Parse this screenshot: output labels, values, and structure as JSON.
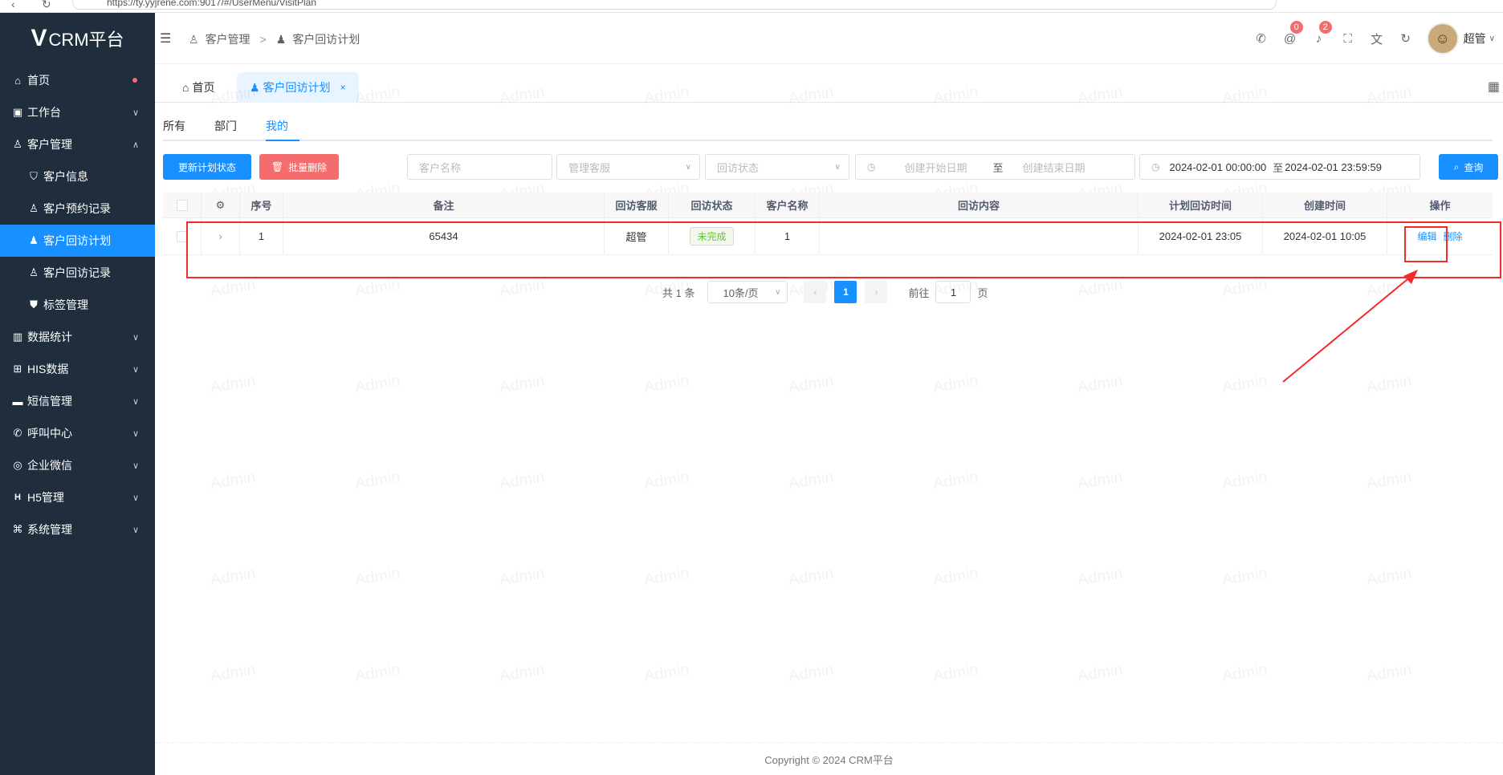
{
  "browser": {
    "url": "https://ty.yyjrene.com:9017/#/UserMenu/VisitPlan"
  },
  "app": {
    "title": "CRM平台",
    "logo_mark": "V"
  },
  "sidebar": {
    "items": [
      {
        "label": "首页",
        "icon": "home-icon"
      },
      {
        "label": "工作台",
        "icon": "briefcase-icon"
      },
      {
        "label": "客户管理",
        "icon": "user-icon"
      },
      {
        "label": "客户信息",
        "icon": "shield-user-icon"
      },
      {
        "label": "客户预约记录",
        "icon": "user-icon"
      },
      {
        "label": "客户回访计划",
        "icon": "user-filled-icon"
      },
      {
        "label": "客户回访记录",
        "icon": "user-icon"
      },
      {
        "label": "标签管理",
        "icon": "shield-check-icon"
      },
      {
        "label": "数据统计",
        "icon": "bar-chart-icon"
      },
      {
        "label": "HIS数据",
        "icon": "medical-box-icon"
      },
      {
        "label": "短信管理",
        "icon": "message-icon"
      },
      {
        "label": "呼叫中心",
        "icon": "phone-icon"
      },
      {
        "label": "企业微信",
        "icon": "wechat-icon"
      },
      {
        "label": "H5管理",
        "icon": "h5-icon"
      },
      {
        "label": "系统管理",
        "icon": "command-icon"
      }
    ]
  },
  "header": {
    "breadcrumb": [
      "客户管理",
      "客户回访计划"
    ],
    "badges": {
      "mentions": "0",
      "notifications": "2"
    },
    "user_name": "超管"
  },
  "tags_view": {
    "home": "首页",
    "current": "客户回访计划"
  },
  "subtabs": [
    "所有",
    "部门",
    "我的"
  ],
  "toolbar": {
    "update_button": "更新计划状态",
    "batch_delete_button": "批量删除",
    "customer_name_placeholder": "客户名称",
    "manager_placeholder": "管理客服",
    "status_placeholder": "回访状态",
    "create_start_placeholder": "创建开始日期",
    "create_end_placeholder": "创建结束日期",
    "range_to": "至",
    "plan_start": "2024-02-01 00:00:00",
    "plan_end": "2024-02-01 23:59:59",
    "query_button": "查询"
  },
  "table": {
    "headers": [
      "序号",
      "备注",
      "回访客服",
      "回访状态",
      "客户名称",
      "回访内容",
      "计划回访时间",
      "创建时间",
      "操作"
    ],
    "rows": [
      {
        "index": "1",
        "remark": "65434",
        "agent": "超管",
        "status": "未完成",
        "customer": "1",
        "content": "",
        "plan_time": "2024-02-01 23:05",
        "create_time": "2024-02-01 10:05",
        "edit": "编辑",
        "delete": "删除"
      }
    ]
  },
  "pagination": {
    "total": "共 1 条",
    "page_size": "10条/页",
    "current_page": "1",
    "goto_label": "前往",
    "goto_value": "1",
    "goto_suffix": "页"
  },
  "watermark": "Admin",
  "footer": {
    "text": "Copyright © 2024 CRM平台"
  },
  "colors": {
    "sidebar_bg": "#1f2d3d",
    "primary": "#1890ff",
    "danger": "#f56c6c",
    "highlight": "#f52a2a"
  }
}
